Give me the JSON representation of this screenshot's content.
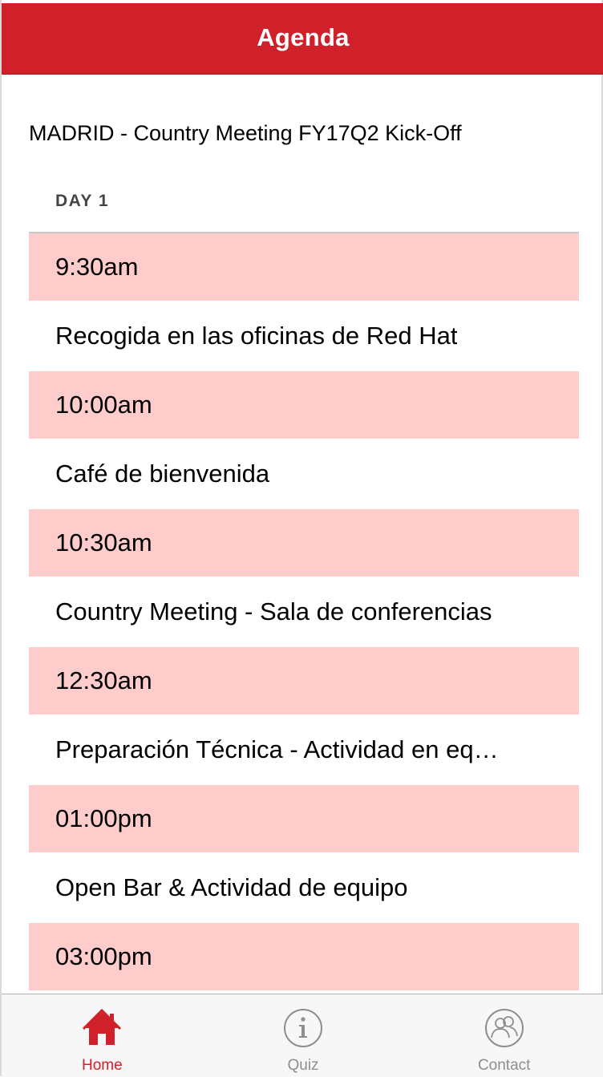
{
  "header": {
    "title": "Agenda"
  },
  "event": {
    "title": "MADRID - Country Meeting FY17Q2 Kick-Off"
  },
  "day": {
    "label": "DAY 1"
  },
  "agenda": [
    {
      "time": "9:30am",
      "description": "Recogida en las oficinas de Red Hat"
    },
    {
      "time": "10:00am",
      "description": "Café de bienvenida"
    },
    {
      "time": "10:30am",
      "description": "Country Meeting - Sala de conferencias"
    },
    {
      "time": "12:30am",
      "description": "Preparación Técnica - Actividad en eq…"
    },
    {
      "time": "01:00pm",
      "description": "Open Bar & Actividad de equipo"
    },
    {
      "time": "03:00pm",
      "description": ""
    }
  ],
  "tabs": [
    {
      "label": "Home",
      "icon": "home-icon",
      "active": true
    },
    {
      "label": "Quiz",
      "icon": "info-icon",
      "active": false
    },
    {
      "label": "Contact",
      "icon": "contacts-icon",
      "active": false
    }
  ],
  "colors": {
    "accent": "#d0202a",
    "time_row_bg": "#ffcccc",
    "tab_inactive": "#8e8e8e"
  }
}
